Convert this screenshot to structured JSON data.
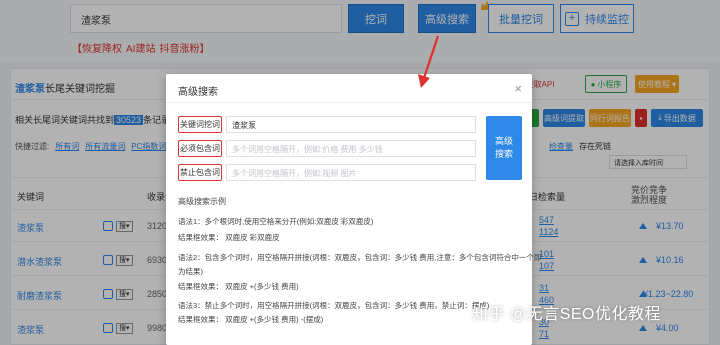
{
  "search": {
    "value": "渣浆泵"
  },
  "toolbar": {
    "dig_label": "挖词",
    "advanced_label": "高级搜索",
    "batch_label": "批量挖词",
    "monitor_label": "持续监控"
  },
  "promo": [
    "【恢复降权",
    "AI建站",
    "抖音涨粉】"
  ],
  "panel": {
    "tab_prefix": "渣浆泵",
    "tab_suffix": "长尾关键词挖掘",
    "summary_prefix": "相关长尾词关键词共找到",
    "summary_count": "30523",
    "summary_suffix": "条记录[PC端",
    "filter_label": "快捷过滤:",
    "filters": [
      "所有词",
      "所有流量词",
      "PC指数词"
    ],
    "col_keyword": "关键词",
    "col_count": "收录量",
    "col_daily": "日检索量",
    "col_price_1": "竞价竞争",
    "col_price_2": "激烈程度",
    "top_buttons": [
      "获取API",
      "小程序",
      "使用教程"
    ],
    "action_buttons": [
      "高级词提取",
      "同行词报告",
      "导出数据"
    ],
    "sort_placeholder": "请选择入库时间",
    "right_links": [
      "检查量",
      "存在死链"
    ],
    "rows": [
      {
        "keyword": "渣浆泵",
        "count": "312000",
        "daily": [
          "547",
          "1124"
        ],
        "price": "¥13.70"
      },
      {
        "keyword": "潜水渣浆泵",
        "count": "693000",
        "daily": [
          "101",
          "107"
        ],
        "price": "¥10.16"
      },
      {
        "keyword": "耐磨渣浆泵",
        "count": "285000",
        "daily": [
          "31",
          "460"
        ],
        "price": "¥1.23~22.80"
      },
      {
        "keyword": "渣浆泵",
        "count": "99800",
        "daily": [
          "30",
          "71"
        ],
        "price": "¥4.00"
      }
    ]
  },
  "modal": {
    "title": "高级搜索",
    "close": "×",
    "fields": [
      {
        "label": "关键词挖词",
        "value": "渣浆泵",
        "placeholder": ""
      },
      {
        "label": "必须包含词",
        "value": "",
        "placeholder": "多个词用空格隔开，例如:价格 费用 多少钱"
      },
      {
        "label": "禁止包含词",
        "value": "",
        "placeholder": "多个词用空格隔开，例如:视频 图片"
      }
    ],
    "submit_line1": "高级",
    "submit_line2": "搜索",
    "examples_title": "高级搜索示例",
    "examples": [
      "语法1：多个根词时,使用空格来分开(例如:双鹿皮 彩双鹿皮)",
      "结果框效果：   双鹿皮 彩双鹿皮",
      "语法2：包含多个词时，用空格隔开拼接(词根：双鹿皮，包含词：多少钱 费用,注意：多个包含词符合中一个即",
      "为结果)",
      "结果框效果：   双鹿皮 +(多少钱 费用)",
      "语法3：禁止多个词时，用空格隔开拼接(词根：双鹿皮，包含词：多少钱 费用，禁止词：摆成)",
      "结果框效果：   双鹿皮 +(多少钱 费用) -(摆成)"
    ]
  },
  "watermark": "知乎 @无言SEO优化教程",
  "colors": {
    "accent": "#2f87e8",
    "warning": "#e0322f",
    "orange": "#f5a623",
    "green": "#2aa846"
  }
}
